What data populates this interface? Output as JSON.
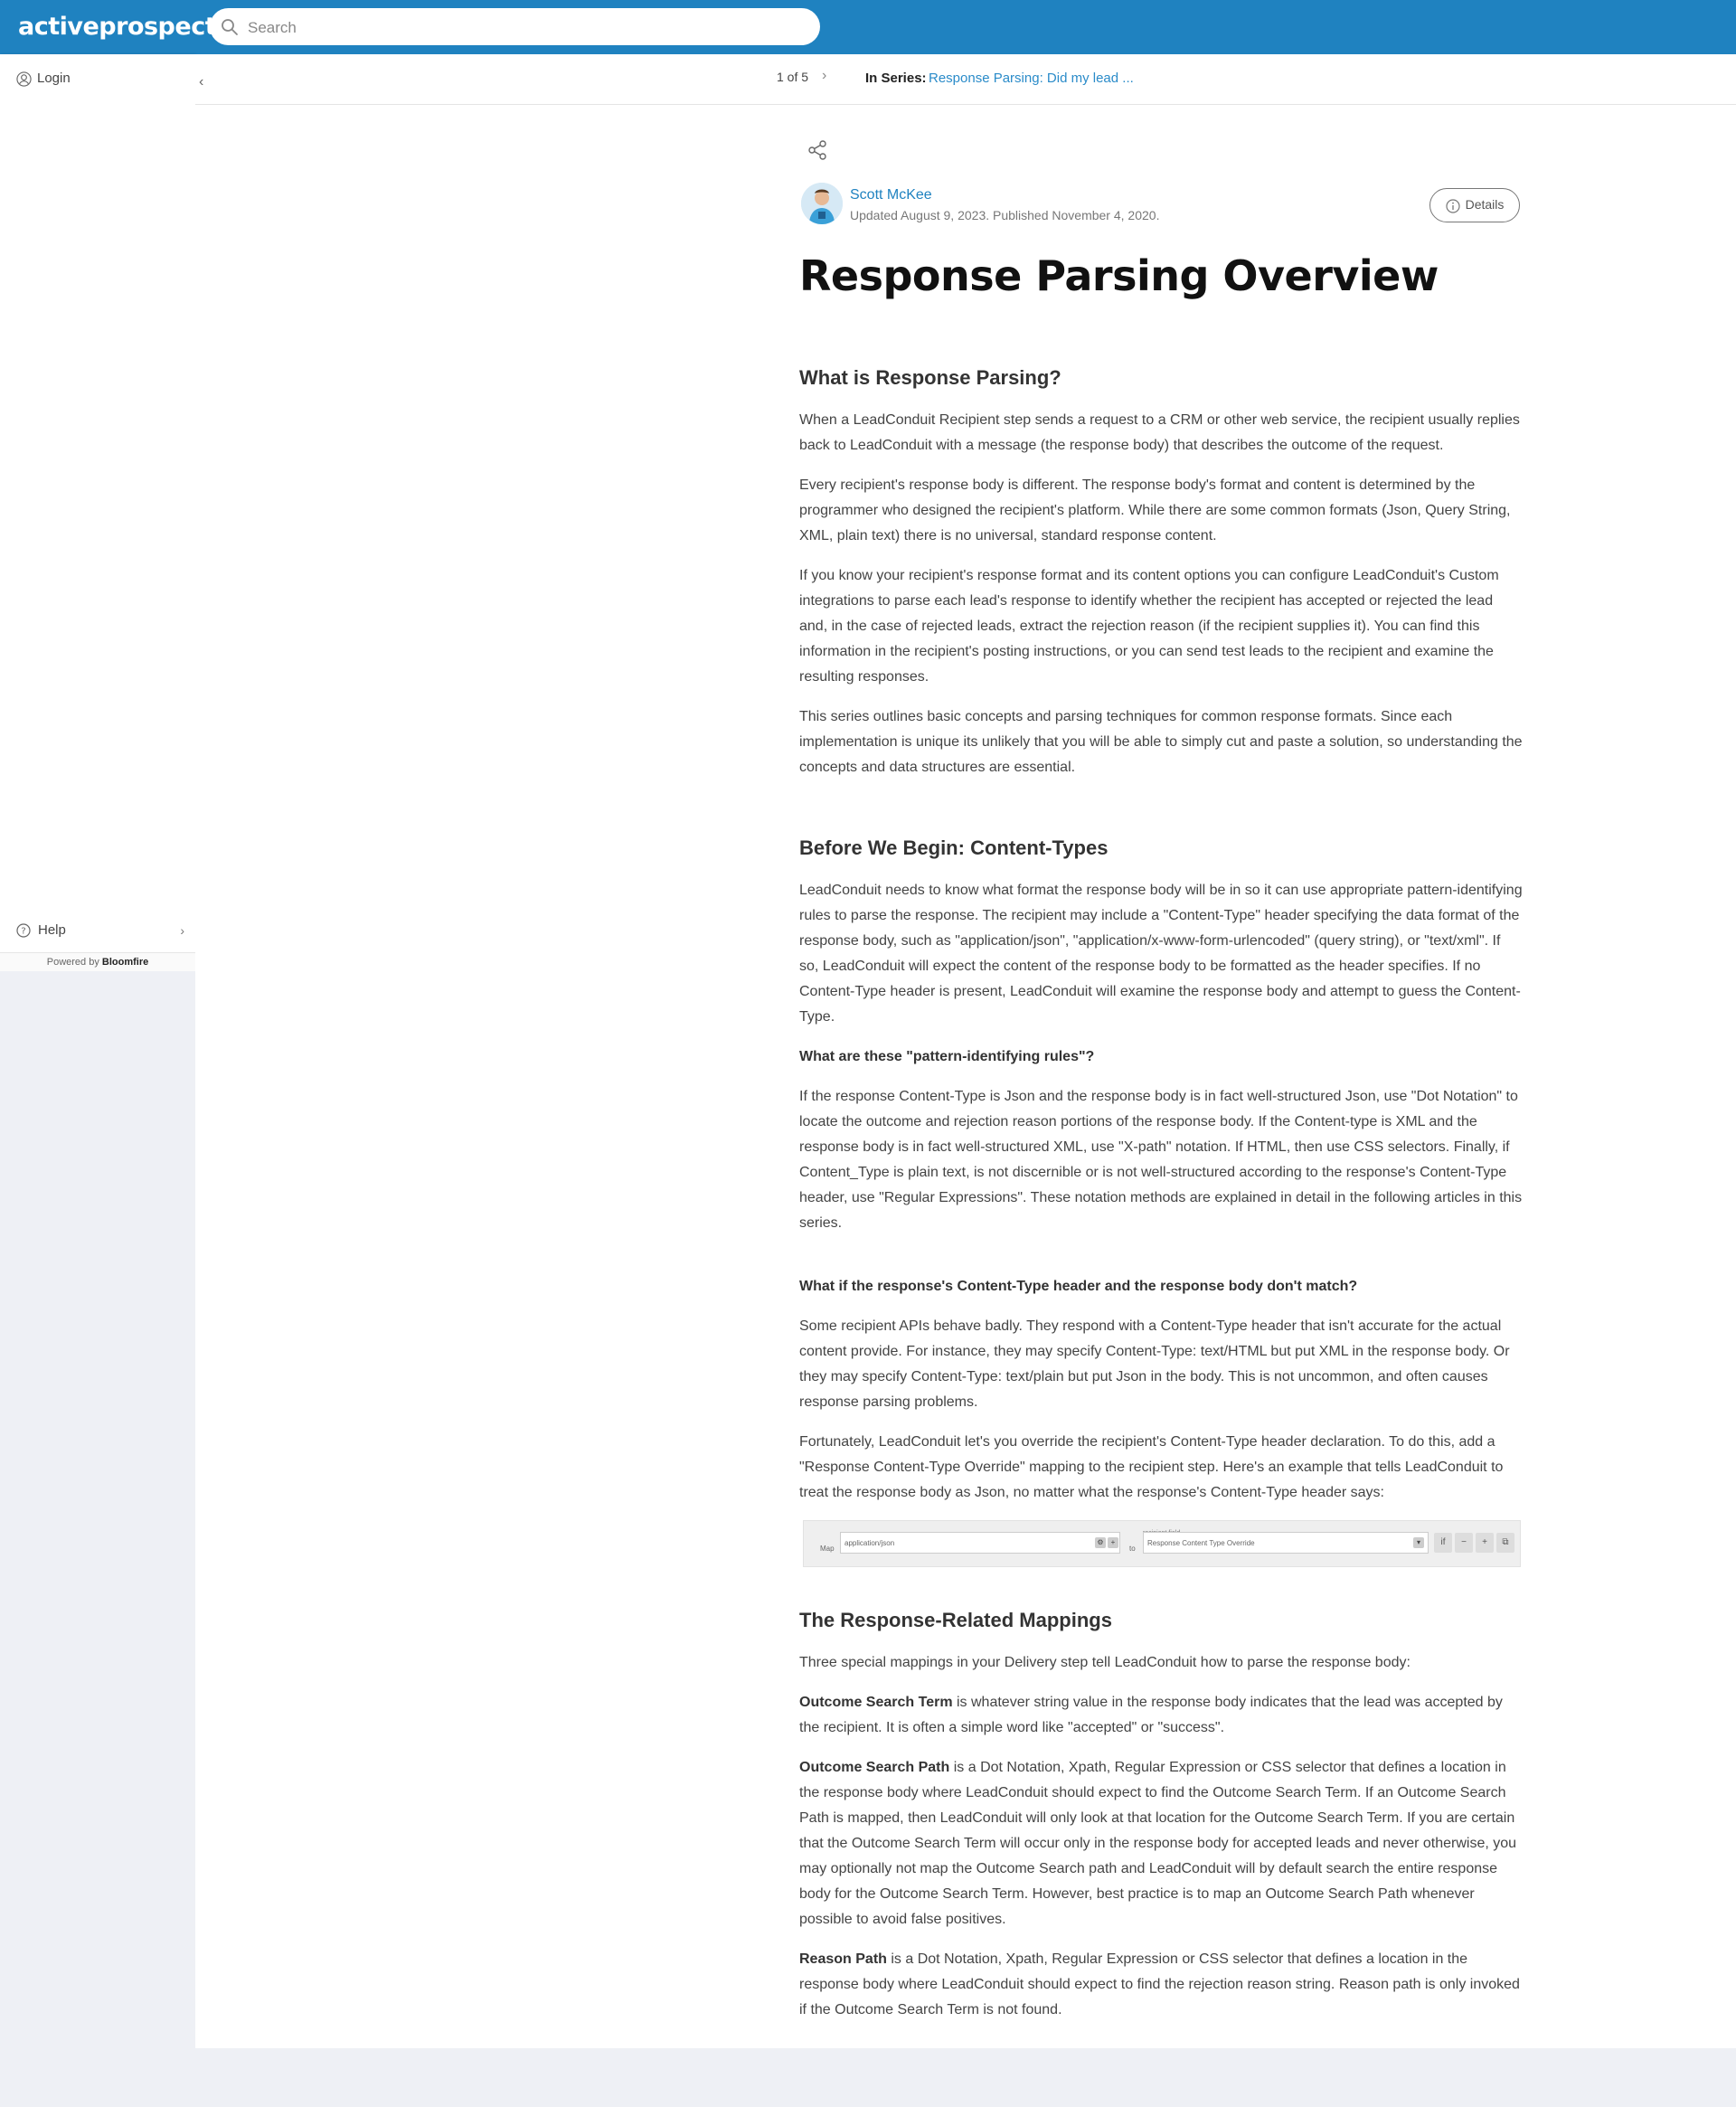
{
  "header": {
    "logo": "activeprospect",
    "search_placeholder": "Search"
  },
  "sidebar": {
    "login_label": "Login",
    "help_label": "Help",
    "help_chevron": "›",
    "powered_prefix": "Powered by",
    "powered_brand": "Bloomfire"
  },
  "series": {
    "collapse": "‹",
    "pager": "1 of 5",
    "next": "›",
    "in_series_label": "In Series:",
    "series_title": "Response Parsing: Did my lead ..."
  },
  "article": {
    "author": "Scott McKee",
    "dates": "Updated August 9, 2023. Published November 4, 2020.",
    "details_label": "Details",
    "title": "Response Parsing Overview",
    "s1_heading": "What is Response Parsing?",
    "s1_p1": "When a LeadConduit Recipient step  sends a request to a CRM or other web service, the recipient usually replies back to LeadConduit with a message (the response body) that describes the outcome of the request.",
    "s1_p2": "Every recipient's response body is different. The response body's format and content is determined by the programmer who designed the recipient's platform. While there are some common formats (Json, Query String, XML, plain text) there is no universal, standard response content.",
    "s1_p3": "If you know your recipient's response format and its content options you can configure LeadConduit's Custom integrations to parse each lead's response to identify whether the recipient has accepted or rejected the lead and, in the case of rejected leads, extract the rejection reason (if the recipient supplies it). You can find this information in the recipient's posting instructions, or you can send test leads to the recipient and examine the resulting responses.",
    "s1_p4": "This series outlines basic concepts and parsing techniques for common response formats. Since each implementation is unique its unlikely that you will be able to simply cut and paste a solution, so understanding the concepts and data structures are essential.",
    "s2_heading": "Before We Begin: Content-Types",
    "s2_p1": "LeadConduit needs to know what format the response body will be in so it can use appropriate pattern-identifying rules to parse the response. The recipient may include a \"Content-Type\" header specifying the data format of the response body, such as \"application/json\", \"application/x-www-form-urlencoded\" (query string), or \"text/xml\". If so, LeadConduit will expect the content of the response body to be formatted as the header specifies. If no Content-Type header is present, LeadConduit will examine the response body and attempt to guess the Content-Type.",
    "s2_q1": "What are these \"pattern-identifying rules\"?",
    "s2_p2": "If the response Content-Type is Json and the response body is in fact well-structured Json, use \"Dot Notation\" to locate the outcome and rejection reason portions of the response body. If the Content-type is XML and the response body is in fact well-structured XML, use \"X-path\" notation. If HTML, then use CSS selectors. Finally, if Content_Type is plain text, is not discernible or is not well-structured according to the response's Content-Type header, use \"Regular Expressions\". These notation methods are explained in detail in the following articles in this series.",
    "s2_q2": "What if the response's Content-Type header and the response body don't match?",
    "s2_p3": "Some recipient APIs behave badly. They respond with a Content-Type header that isn't accurate for the actual content provide. For instance, they may specify Content-Type: text/HTML but put XML in the response body. Or they may specify Content-Type: text/plain but put Json in the body. This is not uncommon, and often causes response parsing problems.",
    "s2_p4": "Fortunately, LeadConduit let's you override the recipient's Content-Type header declaration. To do this, add a \"Response Content-Type Override\" mapping to the recipient step. Here's an example that tells LeadConduit to treat the response body as Json, no matter what the response's Content-Type header says:",
    "mapping": {
      "map_label": "Map",
      "value": "application/json",
      "to_label": "to",
      "recipient_field_label": "recipient field",
      "field": "Response Content Type Override",
      "if_label": "if",
      "minus": "−",
      "plus": "+"
    },
    "s3_heading": "The Response-Related Mappings",
    "s3_p1": "Three special mappings in your Delivery step tell LeadConduit how to parse the response body:",
    "s3_term1": "Outcome Search Term",
    "s3_def1": " is whatever string value in the response body indicates that the lead was accepted by the recipient. It is often a simple word like \"accepted\" or \"success\".",
    "s3_term2": "Outcome Search Path",
    "s3_def2": " is a Dot Notation, Xpath, Regular Expression or CSS selector that defines a location in the response body where LeadConduit should expect to find the Outcome Search Term. If an Outcome Search Path is mapped, then LeadConduit will only look at that location for the Outcome Search Term. If you are certain that the Outcome Search Term will occur only in the response body for accepted leads and never otherwise, you may optionally not map the Outcome Search path and LeadConduit will by default search the entire response body for the Outcome Search Term. However, best practice is to map an Outcome Search Path whenever possible to avoid false positives.",
    "s3_term3": "Reason Path",
    "s3_def3": " is a Dot Notation, Xpath, Regular Expression or CSS selector that defines a location in the response body where LeadConduit should expect to find the rejection reason string. Reason path is only invoked if the Outcome Search Term is not found."
  },
  "colors": {
    "topbar": "#1f82c0",
    "link": "#2a8bc9",
    "page_bg": "#eef0f5"
  },
  "icons": [
    "search-icon",
    "user-icon",
    "help-icon",
    "share-icon",
    "info-icon",
    "avatar"
  ]
}
